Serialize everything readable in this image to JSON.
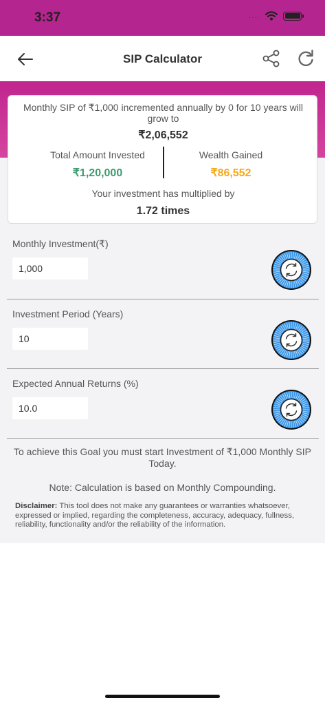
{
  "status_bar": {
    "time": "3:37",
    "signal": "....",
    "wifi_icon": "wifi-icon",
    "battery_icon": "battery-icon"
  },
  "header": {
    "title": "SIP Calculator",
    "back_icon": "arrow-left-icon",
    "share_icon": "share-icon",
    "refresh_icon": "refresh-icon"
  },
  "result": {
    "description": "Monthly SIP of ₹1,000 incremented annually by 0 for 10 years will grow to",
    "future_value": "₹2,06,552",
    "invested_label": "Total Amount Invested",
    "invested_value": "₹1,20,000",
    "gained_label": "Wealth Gained",
    "gained_value": "₹86,552",
    "multiplied_label": "Your investment has multiplied by",
    "multiplied_value": "1.72 times"
  },
  "inputs": [
    {
      "label": "Monthly Investment(₹)",
      "value": "1,000"
    },
    {
      "label": "Investment Period (Years)",
      "value": "10"
    },
    {
      "label": "Expected Annual Returns (%)",
      "value": "10.0"
    }
  ],
  "goal_text": "To achieve this Goal you must start Investment of ₹1,000 Monthly SIP Today.",
  "note": "Note: Calculation is based on Monthly Compounding.",
  "disclaimer": {
    "label": "Disclaimer:",
    "text": " This tool does not make any guarantees or warranties whatsoever, expressed or implied, regarding the completeness, accuracy, adequacy, fullness, reliability, functionality and/or the reliability of the information."
  },
  "colors": {
    "brand": "#b5258f",
    "green": "#3e9b6e",
    "orange": "#f6a81b",
    "dial": "#3a95e6"
  }
}
